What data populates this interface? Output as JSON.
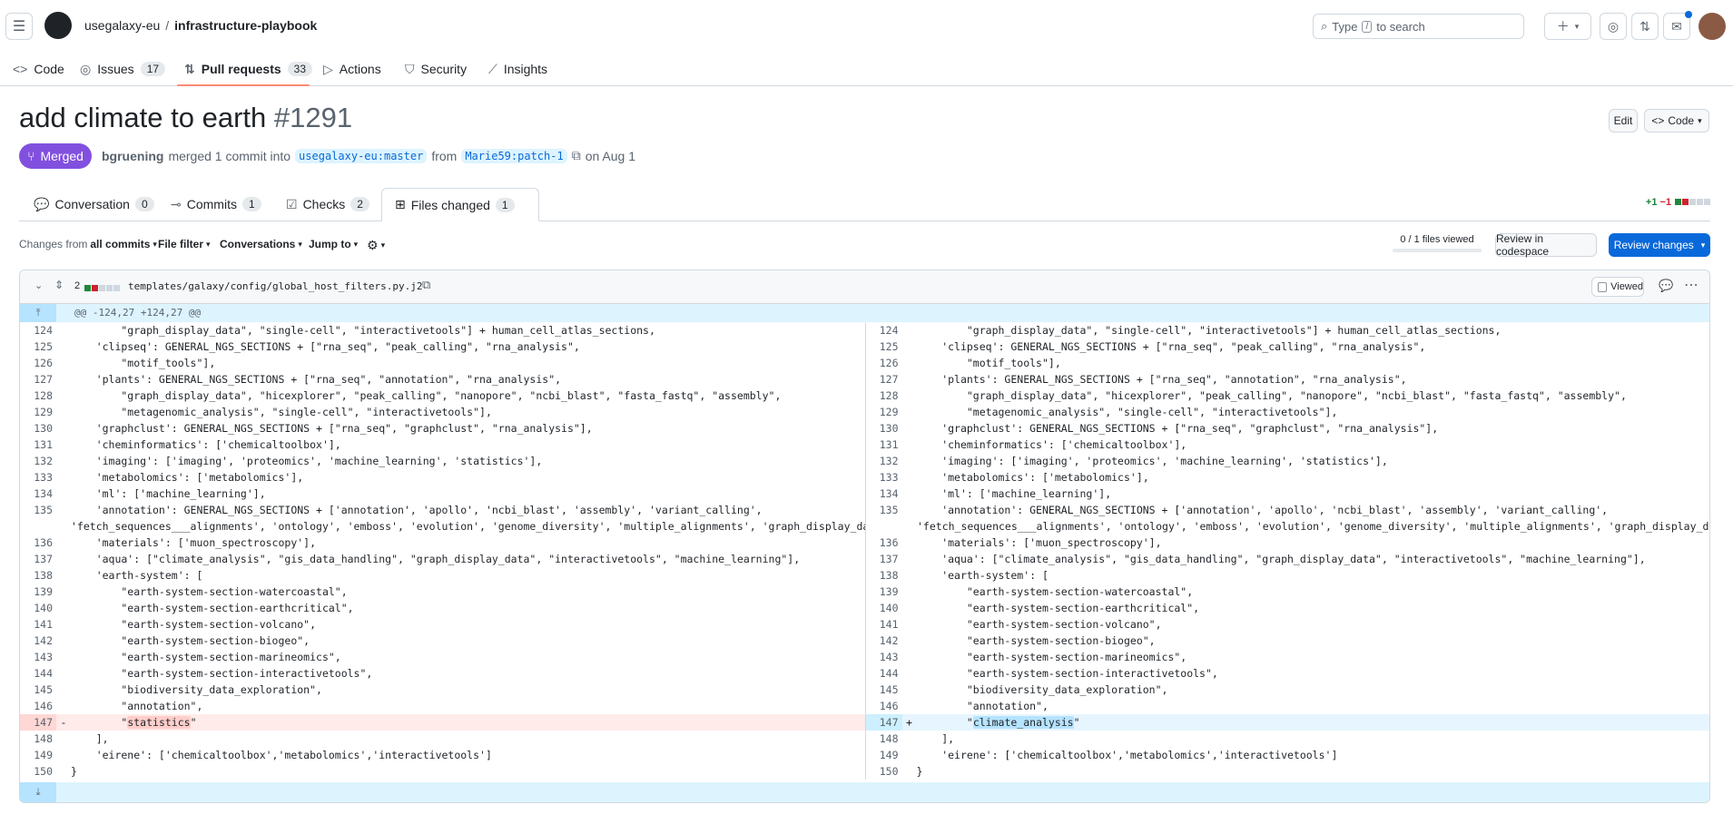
{
  "header": {
    "owner": "usegalaxy-eu",
    "sep": "/",
    "repo": "infrastructure-playbook",
    "search_prefix": "Type",
    "search_key": "/",
    "search_suffix": "to search"
  },
  "repo_nav": {
    "code": "Code",
    "issues": "Issues",
    "issues_count": "17",
    "pulls": "Pull requests",
    "pulls_count": "33",
    "actions": "Actions",
    "security": "Security",
    "insights": "Insights"
  },
  "pr": {
    "title": "add climate to earth",
    "number": "#1291",
    "edit": "Edit",
    "code": "Code",
    "state": "Merged",
    "author": "bgruening",
    "merged_text": "merged 1 commit into",
    "base": "usegalaxy-eu:master",
    "from": "from",
    "head": "Marie59:patch-1",
    "date": "on Aug 1"
  },
  "tabs": {
    "conversation": "Conversation",
    "conversation_count": "0",
    "commits": "Commits",
    "commits_count": "1",
    "checks": "Checks",
    "checks_count": "2",
    "files": "Files changed",
    "files_count": "1",
    "add_stat": "+1",
    "del_stat": "−1"
  },
  "toolbar": {
    "changes_from": "Changes from",
    "all_commits": "all commits",
    "file_filter": "File filter",
    "conversations": "Conversations",
    "jump_to": "Jump to",
    "files_viewed": "0 / 1 files viewed",
    "review_codespace": "Review in codespace",
    "review_changes": "Review changes"
  },
  "file": {
    "changes": "2",
    "path": "templates/galaxy/config/global_host_filters.py.j2",
    "viewed": "Viewed",
    "hunk": "@@ -124,27 +124,27 @@"
  },
  "diff_rows": [
    {
      "n": "124",
      "code": "        \"graph_display_data\", \"single-cell\", \"interactivetools\"] + human_cell_atlas_sections,"
    },
    {
      "n": "125",
      "code": "    'clipseq': GENERAL_NGS_SECTIONS + [\"rna_seq\", \"peak_calling\", \"rna_analysis\","
    },
    {
      "n": "126",
      "code": "        \"motif_tools\"],"
    },
    {
      "n": "127",
      "code": "    'plants': GENERAL_NGS_SECTIONS + [\"rna_seq\", \"annotation\", \"rna_analysis\","
    },
    {
      "n": "128",
      "code": "        \"graph_display_data\", \"hicexplorer\", \"peak_calling\", \"nanopore\", \"ncbi_blast\", \"fasta_fastq\", \"assembly\","
    },
    {
      "n": "129",
      "code": "        \"metagenomic_analysis\", \"single-cell\", \"interactivetools\"],"
    },
    {
      "n": "130",
      "code": "    'graphclust': GENERAL_NGS_SECTIONS + [\"rna_seq\", \"graphclust\", \"rna_analysis\"],"
    },
    {
      "n": "131",
      "code": "    'cheminformatics': ['chemicaltoolbox'],"
    },
    {
      "n": "132",
      "code": "    'imaging': ['imaging', 'proteomics', 'machine_learning', 'statistics'],"
    },
    {
      "n": "133",
      "code": "    'metabolomics': ['metabolomics'],"
    },
    {
      "n": "134",
      "code": "    'ml': ['machine_learning'],"
    },
    {
      "n": "135",
      "code": "    'annotation': GENERAL_NGS_SECTIONS + ['annotation', 'apollo', 'ncbi_blast', 'assembly', 'variant_calling',"
    },
    {
      "n": "",
      "code": "'fetch_sequences___alignments', 'ontology', 'emboss', 'evolution', 'genome_diversity', 'multiple_alignments', 'graph_display_data'],"
    },
    {
      "n": "136",
      "code": "    'materials': ['muon_spectroscopy'],"
    },
    {
      "n": "137",
      "code": "    'aqua': [\"climate_analysis\", \"gis_data_handling\", \"graph_display_data\", \"interactivetools\", \"machine_learning\"],"
    },
    {
      "n": "138",
      "code": "    'earth-system': ["
    },
    {
      "n": "139",
      "code": "        \"earth-system-section-watercoastal\","
    },
    {
      "n": "140",
      "code": "        \"earth-system-section-earthcritical\","
    },
    {
      "n": "141",
      "code": "        \"earth-system-section-volcano\","
    },
    {
      "n": "142",
      "code": "        \"earth-system-section-biogeo\","
    },
    {
      "n": "143",
      "code": "        \"earth-system-section-marineomics\","
    },
    {
      "n": "144",
      "code": "        \"earth-system-section-interactivetools\","
    },
    {
      "n": "145",
      "code": "        \"biodiversity_data_exploration\","
    },
    {
      "n": "146",
      "code": "        \"annotation\","
    }
  ],
  "changed_row": {
    "n": "147",
    "del_sign": "-",
    "add_sign": "+",
    "indent": "        ",
    "del_quote_open": "\"",
    "del_word": "statistics",
    "del_quote_close": "\"",
    "add_quote_open": "\"",
    "add_word": "climate_analysis",
    "add_quote_close": "\""
  },
  "tail_rows": [
    {
      "n": "148",
      "code": "    ],"
    },
    {
      "n": "149",
      "code": "    'eirene': ['chemicaltoolbox','metabolomics','interactivetools']"
    },
    {
      "n": "150",
      "code": "}"
    }
  ]
}
